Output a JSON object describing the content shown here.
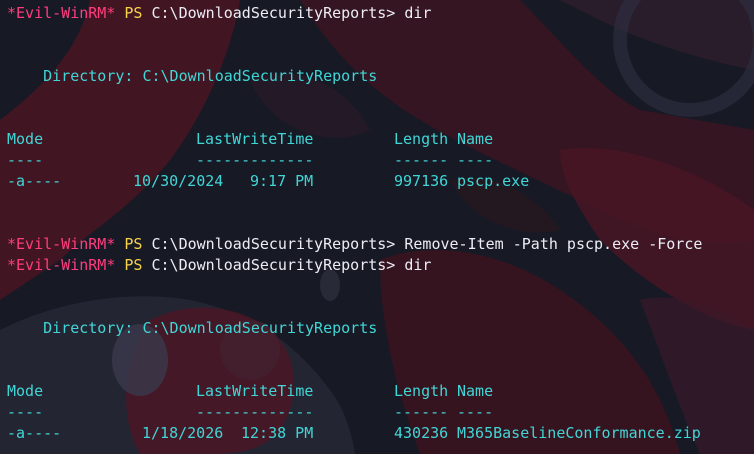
{
  "terminal": {
    "prompt": {
      "name": "*Evil-WinRM*",
      "shell": "PS",
      "path": "C:\\DownloadSecurityReports>"
    },
    "blocks": [
      {
        "command": "dir",
        "directory_label": "Directory:",
        "directory_path": "C:\\DownloadSecurityReports",
        "headers": {
          "mode": "Mode",
          "lastwrite": "LastWriteTime",
          "length": "Length",
          "name": "Name"
        },
        "underlines": {
          "mode": "----",
          "lastwrite": "-------------",
          "length": "------",
          "name": "----"
        },
        "rows": [
          {
            "mode": "-a----",
            "date": "10/30/2024",
            "time": "9:17 PM",
            "length": "997136",
            "name": "pscp.exe"
          }
        ]
      },
      {
        "command": "Remove-Item -Path pscp.exe -Force"
      },
      {
        "command": "dir",
        "directory_label": "Directory:",
        "directory_path": "C:\\DownloadSecurityReports",
        "headers": {
          "mode": "Mode",
          "lastwrite": "LastWriteTime",
          "length": "Length",
          "name": "Name"
        },
        "underlines": {
          "mode": "----",
          "lastwrite": "-------------",
          "length": "------",
          "name": "----"
        },
        "rows": [
          {
            "mode": "-a----",
            "date": "1/18/2026",
            "time": "12:38 PM",
            "length": "430236",
            "name": "M365BaselineConformance.zip"
          }
        ]
      }
    ]
  }
}
